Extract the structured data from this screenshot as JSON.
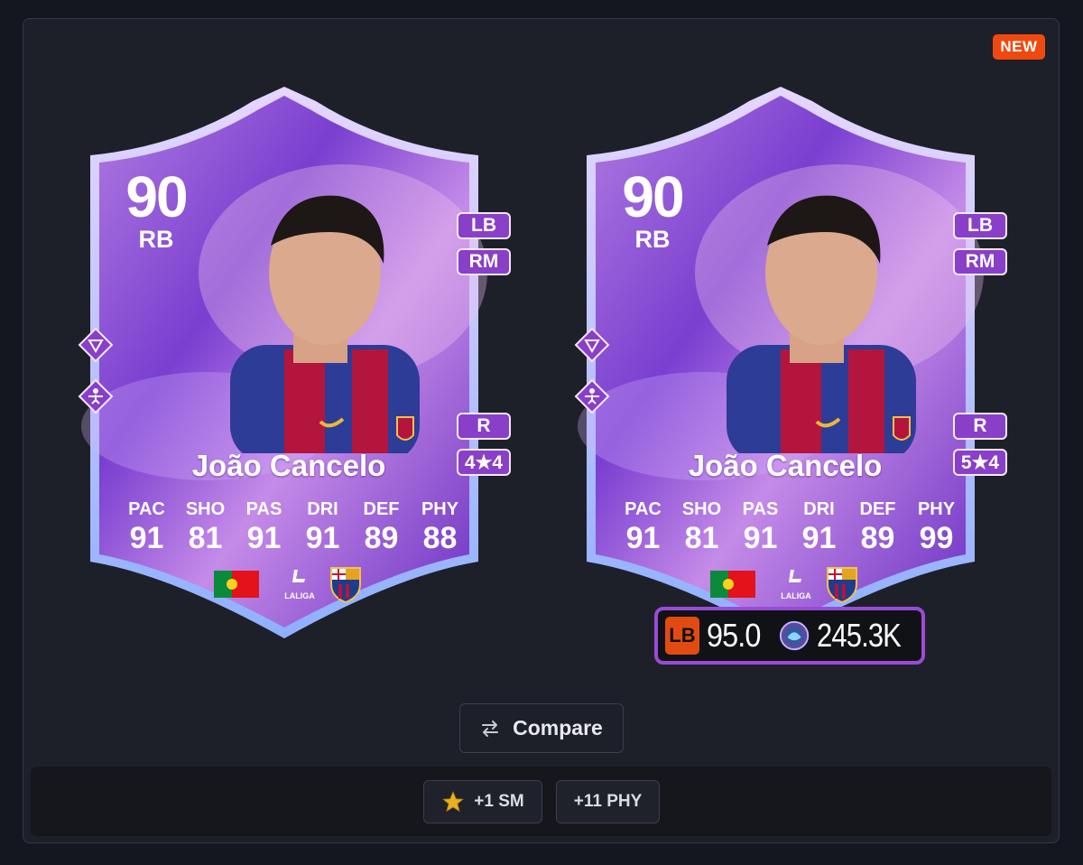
{
  "badge": {
    "new_label": "NEW"
  },
  "cards": [
    {
      "rating": "90",
      "position": "RB",
      "alt_positions": [
        "LB",
        "RM"
      ],
      "foot": "R",
      "skills_weak": "4★4",
      "name": "João Cancelo",
      "stats": [
        {
          "label": "PAC",
          "value": "91"
        },
        {
          "label": "SHO",
          "value": "81"
        },
        {
          "label": "PAS",
          "value": "91"
        },
        {
          "label": "DRI",
          "value": "91"
        },
        {
          "label": "DEF",
          "value": "89"
        },
        {
          "label": "PHY",
          "value": "88"
        }
      ],
      "nation_icon": "portugal-flag",
      "league_icon": "laliga-logo",
      "league_text": "LALIGA",
      "club_icon": "barcelona-crest"
    },
    {
      "rating": "90",
      "position": "RB",
      "alt_positions": [
        "LB",
        "RM"
      ],
      "foot": "R",
      "skills_weak": "5★4",
      "name": "João Cancelo",
      "stats": [
        {
          "label": "PAC",
          "value": "91"
        },
        {
          "label": "SHO",
          "value": "81"
        },
        {
          "label": "PAS",
          "value": "91"
        },
        {
          "label": "DRI",
          "value": "91"
        },
        {
          "label": "DEF",
          "value": "89"
        },
        {
          "label": "PHY",
          "value": "99"
        }
      ],
      "nation_icon": "portugal-flag",
      "league_icon": "laliga-logo",
      "league_text": "LALIGA",
      "club_icon": "barcelona-crest"
    }
  ],
  "price_bar": {
    "pos_label": "LB",
    "score": "95.0",
    "price": "245.3K"
  },
  "compare": {
    "label": "Compare",
    "icon": "swap-arrows-icon"
  },
  "upgrades": [
    {
      "label": "+1 SM",
      "icon": "star-icon"
    },
    {
      "label": "+11 PHY"
    }
  ],
  "colors": {
    "accent_purple": "#8a3fc8",
    "new_badge": "#f0490f",
    "lb_chip": "#e14b11"
  }
}
